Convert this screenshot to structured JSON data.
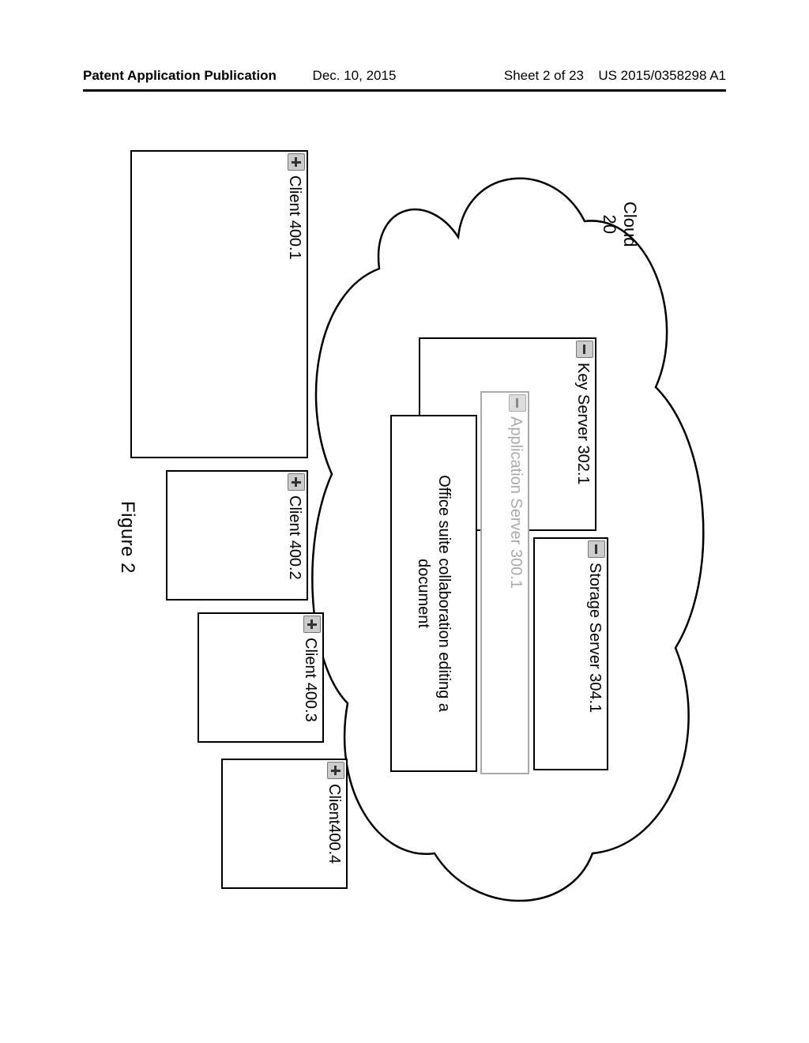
{
  "header": {
    "left": "Patent Application Publication",
    "date": "Dec. 10, 2015",
    "sheet": "Sheet 2 of 23",
    "pubno": "US 2015/0358298 A1"
  },
  "cloud": {
    "label_l1": "Cloud",
    "label_l2": "20"
  },
  "servers": {
    "key": "Key Server 302.1",
    "storage": "Storage Server 304.1",
    "app": "Application Server 300.1",
    "app_inner_l1": "Office suite collaboration editing a",
    "app_inner_l2": "document"
  },
  "clients": {
    "c1": "Client 400.1",
    "c2": "Client 400.2",
    "c3": "Client 400.3",
    "c4": "Client400.4"
  },
  "figure_label": "Figure 2"
}
